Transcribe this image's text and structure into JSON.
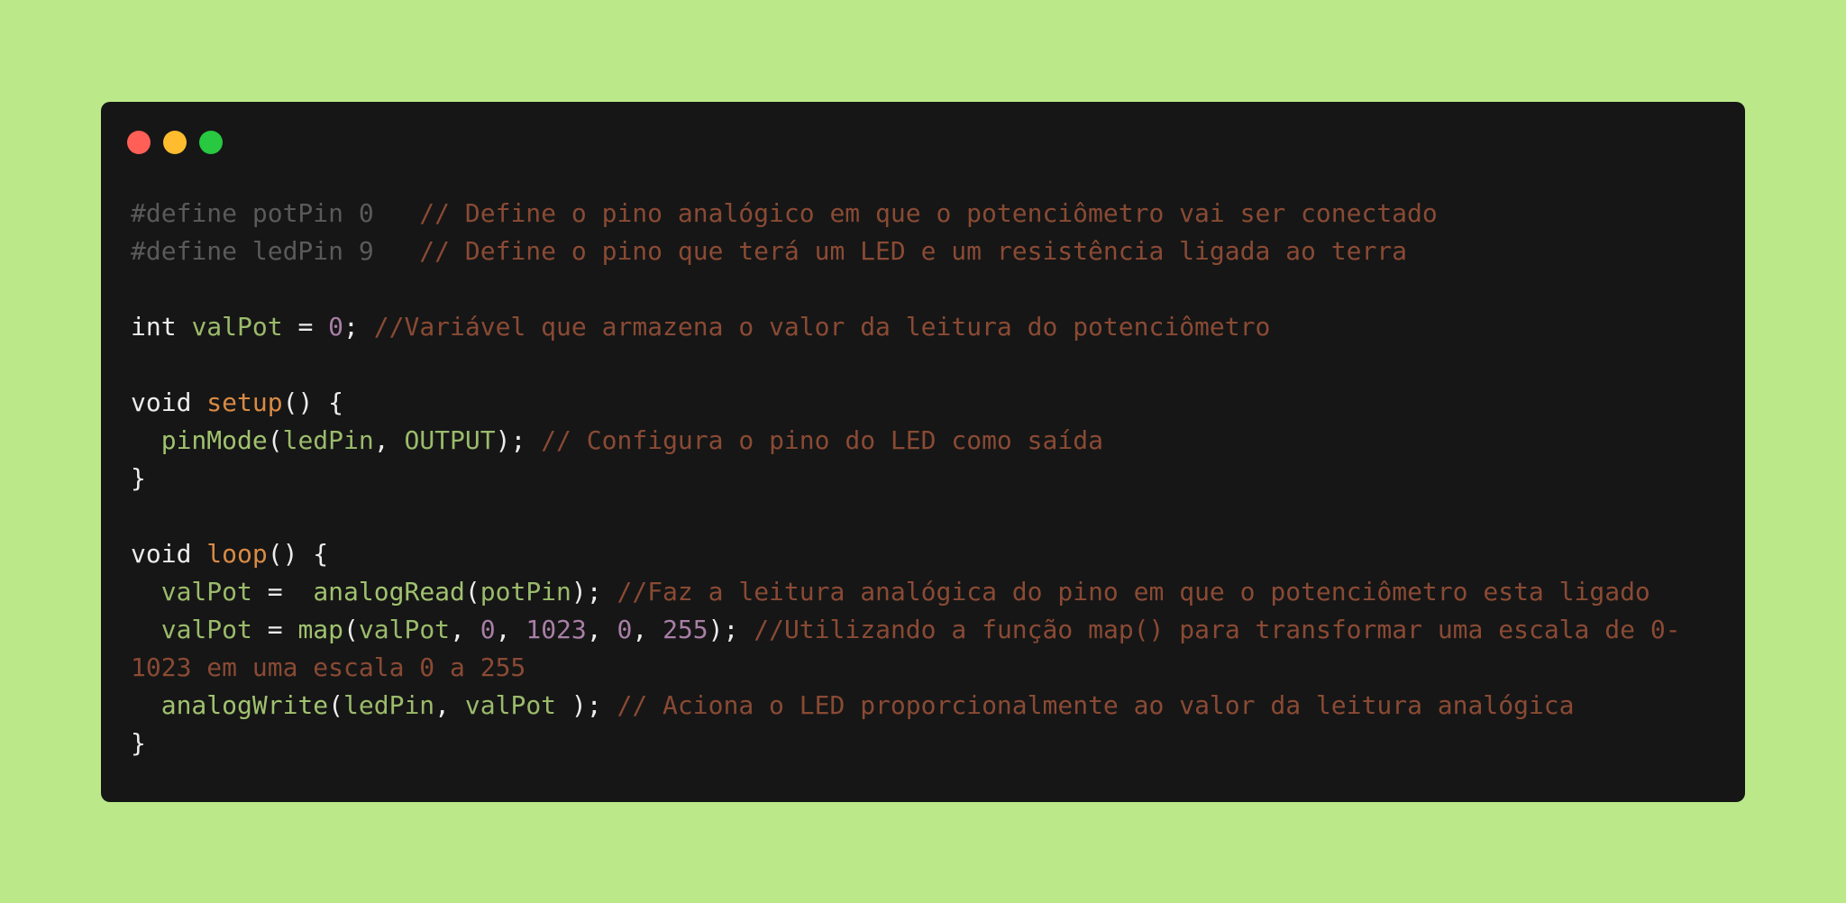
{
  "colors": {
    "page_background": "#bbe98a",
    "window_background": "#161616",
    "close": "#ff5f57",
    "minimize": "#febc2e",
    "maximize": "#28c840"
  },
  "window_controls": {
    "close": "close-dot-icon",
    "minimize": "minimize-dot-icon",
    "maximize": "maximize-dot-icon"
  },
  "code_lines": [
    [
      {
        "t": "#define potPin 0   ",
        "c": "pre"
      },
      {
        "t": "// Define o pino analógico em que o potenciômetro vai ser conectado",
        "c": "com"
      }
    ],
    [
      {
        "t": "#define ledPin 9   ",
        "c": "pre"
      },
      {
        "t": "// Define o pino que terá um LED e um resistência ligada ao terra",
        "c": "com"
      }
    ],
    [],
    [
      {
        "t": "int ",
        "c": "kw"
      },
      {
        "t": "valPot",
        "c": "var"
      },
      {
        "t": " = ",
        "c": "op"
      },
      {
        "t": "0",
        "c": "num"
      },
      {
        "t": "; ",
        "c": "op"
      },
      {
        "t": "//Variável que armazena o valor da leitura do potenciômetro",
        "c": "com"
      }
    ],
    [],
    [
      {
        "t": "void ",
        "c": "kw"
      },
      {
        "t": "setup",
        "c": "fn"
      },
      {
        "t": "() {",
        "c": "op"
      }
    ],
    [
      {
        "t": "  ",
        "c": "op"
      },
      {
        "t": "pinMode",
        "c": "call"
      },
      {
        "t": "(",
        "c": "op"
      },
      {
        "t": "ledPin",
        "c": "var"
      },
      {
        "t": ", ",
        "c": "op"
      },
      {
        "t": "OUTPUT",
        "c": "var"
      },
      {
        "t": "); ",
        "c": "op"
      },
      {
        "t": "// Configura o pino do LED como saída",
        "c": "com"
      }
    ],
    [
      {
        "t": "}",
        "c": "op"
      }
    ],
    [],
    [
      {
        "t": "void ",
        "c": "kw"
      },
      {
        "t": "loop",
        "c": "fn"
      },
      {
        "t": "() {",
        "c": "op"
      }
    ],
    [
      {
        "t": "  ",
        "c": "op"
      },
      {
        "t": "valPot",
        "c": "var"
      },
      {
        "t": " =  ",
        "c": "op"
      },
      {
        "t": "analogRead",
        "c": "call"
      },
      {
        "t": "(",
        "c": "op"
      },
      {
        "t": "potPin",
        "c": "var"
      },
      {
        "t": "); ",
        "c": "op"
      },
      {
        "t": "//Faz a leitura analógica do pino em que o potenciômetro esta ligado",
        "c": "com"
      }
    ],
    [
      {
        "t": "  ",
        "c": "op"
      },
      {
        "t": "valPot",
        "c": "var"
      },
      {
        "t": " = ",
        "c": "op"
      },
      {
        "t": "map",
        "c": "call"
      },
      {
        "t": "(",
        "c": "op"
      },
      {
        "t": "valPot",
        "c": "var"
      },
      {
        "t": ", ",
        "c": "op"
      },
      {
        "t": "0",
        "c": "num"
      },
      {
        "t": ", ",
        "c": "op"
      },
      {
        "t": "1023",
        "c": "num"
      },
      {
        "t": ", ",
        "c": "op"
      },
      {
        "t": "0",
        "c": "num"
      },
      {
        "t": ", ",
        "c": "op"
      },
      {
        "t": "255",
        "c": "num"
      },
      {
        "t": "); ",
        "c": "op"
      },
      {
        "t": "//Utilizando a função map() para transformar uma escala de 0-",
        "c": "com"
      }
    ],
    [
      {
        "t": "1023 em uma escala 0 a 255",
        "c": "com"
      }
    ],
    [
      {
        "t": "  ",
        "c": "op"
      },
      {
        "t": "analogWrite",
        "c": "call"
      },
      {
        "t": "(",
        "c": "op"
      },
      {
        "t": "ledPin",
        "c": "var"
      },
      {
        "t": ", ",
        "c": "op"
      },
      {
        "t": "valPot",
        "c": "var"
      },
      {
        "t": " ); ",
        "c": "op"
      },
      {
        "t": "// Aciona o LED proporcionalmente ao valor da leitura analógica",
        "c": "com"
      }
    ],
    [
      {
        "t": "}",
        "c": "op"
      }
    ]
  ]
}
